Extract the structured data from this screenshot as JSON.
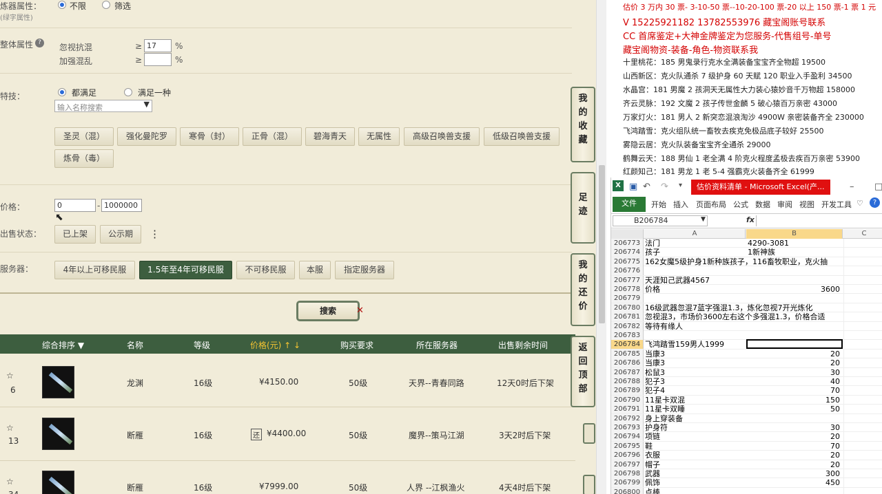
{
  "filters": {
    "lianqi_label": "炼器属性：",
    "lianqi_sub": "(绿字属性)",
    "lianqi_opts": [
      "不限",
      "筛选"
    ],
    "overall_label": "整体属性",
    "overall_rows": [
      {
        "name": "忽视抗混",
        "op": "≥",
        "value": "17",
        "unit": "%"
      },
      {
        "name": "加强混乱",
        "op": "≥",
        "value": "",
        "unit": "%"
      }
    ],
    "skill_label": "特技：",
    "skill_opts": [
      "都满足",
      "满足一种"
    ],
    "skill_placeholder": "输入名称搜索",
    "skills": [
      "圣灵（混）",
      "强化曼陀罗",
      "寒骨（封）",
      "正骨（混）",
      "碧海青天",
      "无属性",
      "高级召唤兽支援",
      "低级召唤兽支援",
      "炼骨（毒）"
    ],
    "price_label": "价格：",
    "price_min": "0",
    "price_sep": "-",
    "price_max": "1000000",
    "status_label": "出售状态：",
    "status_opts": [
      "已上架",
      "公示期"
    ],
    "server_label": "服务器：",
    "server_opts": [
      "4年以上可移民服",
      "1.5年至4年可移民服",
      "不可移民服",
      "本服",
      "指定服务器"
    ],
    "search_btn": "搜索"
  },
  "side_buttons": [
    [
      "我",
      "的",
      "收",
      "藏"
    ],
    [
      "足",
      "迹"
    ],
    [
      "我",
      "的",
      "还",
      "价"
    ],
    [
      "返",
      "回",
      "顶",
      "部"
    ]
  ],
  "table": {
    "headers": [
      "综合排序 ▼",
      "名称",
      "等级",
      "价格(元) ↑ ↓",
      "购买要求",
      "所在服务器",
      "出售剩余时间"
    ],
    "rows": [
      {
        "fav": "6",
        "name": "龙渊",
        "level": "16级",
        "price": "¥4150.00",
        "bargain": "",
        "req": "50级",
        "server": "天界--青春同路",
        "time": "12天0时后下架"
      },
      {
        "fav": "13",
        "name": "断雁",
        "level": "16级",
        "price": "¥4400.00",
        "bargain": "还",
        "req": "50级",
        "server": "魔界--策马江湖",
        "time": "3天2时后下架"
      },
      {
        "fav": "34",
        "name": "断雁",
        "level": "16级",
        "price": "¥7999.00",
        "bargain": "",
        "req": "50级",
        "server": "人界 --江枫渔火",
        "time": "4天4时后下架"
      }
    ]
  },
  "notes": {
    "red_lines": [
      "估价 3 万内 30 票- 3-10-50 票--10-20-100 票-20 以上 150 票-1 票 1 元",
      "V 15225921182      13782553976     藏宝阁账号联系",
      "CC 首席鉴定+大神金牌鉴定为您服务-代售组号-单号",
      "藏宝阁物资-装备-角色-物资联系我"
    ],
    "black_lines": [
      "十里桃花：185 男鬼录行克水全满装备宝宝齐全物超 19500",
      "山西新区：克火队通杀 7 级护身 60 天赋 120 职业入手盈利 34500",
      "水晶宫：181 男魔 2 孩洞天无属性大力装心猿妙音千万物超 158000",
      "齐云灵脉：192 文魔 2 孩子传世金麟 5 破心猿百万亲密 43000",
      "万家灯火：181 男人 2 新突恋混浪淘沙 4900W 亲密装备齐全 230000",
      "飞鸿踏雪：克火组队统一畜牧去疾克免极品底子较好 25500",
      "雾隐云居：克火队装备宝宝齐全通杀 29000",
      "鹤舞云天：188 男仙 1 老全满 4 阶克火程度孟极去疾百万亲密 53900",
      "红颜知己：181 男龙 1 老 5-4 强霸克火装备齐全 61999"
    ]
  },
  "excel": {
    "title": "估价资料清单 - Microsoft Excel(产...",
    "tabs": [
      "文件",
      "开始",
      "插入",
      "页面布局",
      "公式",
      "数据",
      "审阅",
      "视图",
      "开发工具"
    ],
    "name_box": "B206784",
    "fx": "fx",
    "cols": [
      "A",
      "B",
      "C"
    ],
    "rows": [
      {
        "n": "206773",
        "a": "法门",
        "b": "4290-3081",
        "bl": true
      },
      {
        "n": "206774",
        "a": "孩子",
        "b": "1新神族",
        "bl": true
      },
      {
        "n": "206775",
        "a": "162女魔5级护身1新种族孩子，116畜牧职业，克火抽",
        "b": ""
      },
      {
        "n": "206776",
        "a": "",
        "b": ""
      },
      {
        "n": "206777",
        "a": "天涯知己武器4567",
        "b": ""
      },
      {
        "n": "206778",
        "a": "价格",
        "b": "3600"
      },
      {
        "n": "206779",
        "a": "",
        "b": ""
      },
      {
        "n": "206780",
        "a": "16级武器忽混7蓝字强混1.3，炼化忽视7开光炼化",
        "b": ""
      },
      {
        "n": "206781",
        "a": "忽视混3，市场价3600左右这个多强混1.3，价格合适",
        "b": ""
      },
      {
        "n": "206782",
        "a": "等待有缘人",
        "b": ""
      },
      {
        "n": "206783",
        "a": "",
        "b": ""
      },
      {
        "n": "206784",
        "a": "飞鸿踏雪159男人1999",
        "b": "",
        "sel": true
      },
      {
        "n": "206785",
        "a": "当康3",
        "b": "20"
      },
      {
        "n": "206786",
        "a": "当康3",
        "b": "20"
      },
      {
        "n": "206787",
        "a": "松鼠3",
        "b": "30"
      },
      {
        "n": "206788",
        "a": "犯子3",
        "b": "40"
      },
      {
        "n": "206789",
        "a": "犯子4",
        "b": "70"
      },
      {
        "n": "206790",
        "a": "11星卡双混",
        "b": "150"
      },
      {
        "n": "206791",
        "a": "11星卡双睡",
        "b": "50"
      },
      {
        "n": "206792",
        "a": "身上穿装备",
        "b": ""
      },
      {
        "n": "206793",
        "a": "护身符",
        "b": "30"
      },
      {
        "n": "206794",
        "a": "项链",
        "b": "20"
      },
      {
        "n": "206795",
        "a": "鞋",
        "b": "70"
      },
      {
        "n": "206796",
        "a": "衣服",
        "b": "20"
      },
      {
        "n": "206797",
        "a": "帽子",
        "b": "20"
      },
      {
        "n": "206798",
        "a": "武器",
        "b": "300"
      },
      {
        "n": "206799",
        "a": "佩饰",
        "b": "450"
      },
      {
        "n": "206800",
        "a": "点棒",
        "b": ""
      }
    ]
  }
}
